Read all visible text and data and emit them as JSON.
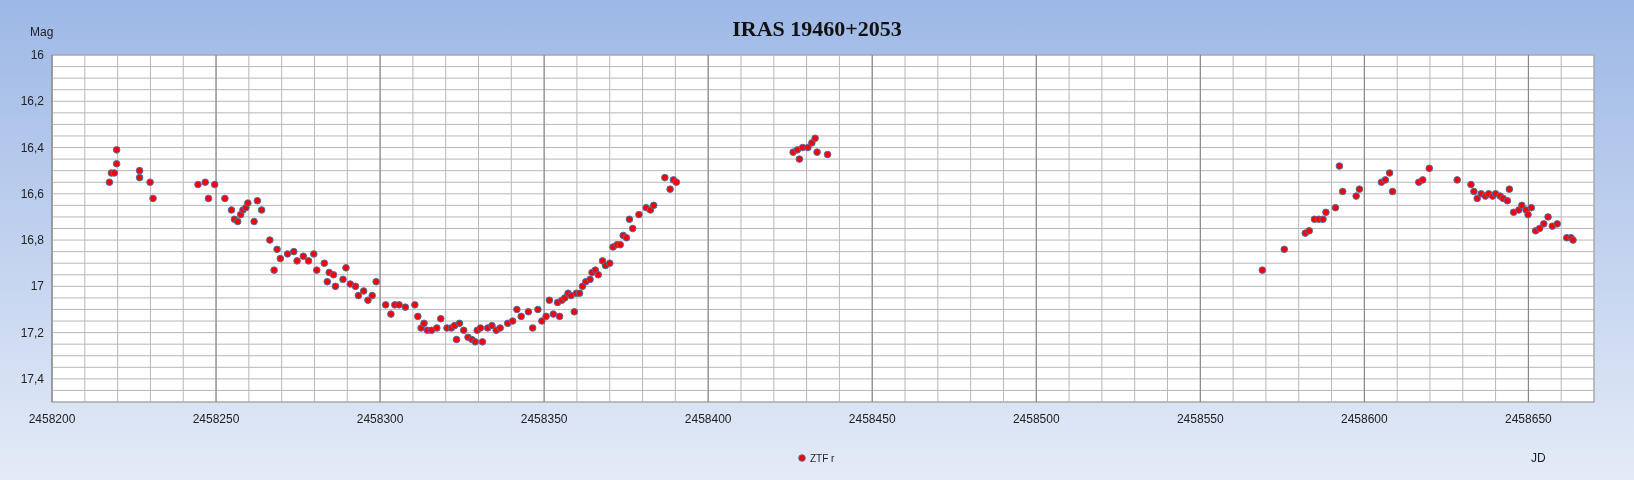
{
  "chart_data": {
    "type": "scatter",
    "grid": true,
    "title": "IRAS 19460+2053",
    "xlabel": "JD",
    "ylabel": "Mag",
    "xlim": [
      2458200,
      2458670
    ],
    "ylim": [
      17.5,
      16
    ],
    "xticks": [
      2458200,
      2458250,
      2458300,
      2458350,
      2458400,
      2458450,
      2458500,
      2458550,
      2458600,
      2458650
    ],
    "yticks": [
      {
        "value": 16,
        "label": "16"
      },
      {
        "value": 16.2,
        "label": "16,2"
      },
      {
        "value": 16.4,
        "label": "16,4"
      },
      {
        "value": 16.6,
        "label": "16,6"
      },
      {
        "value": 16.8,
        "label": "16,8"
      },
      {
        "value": 17,
        "label": "17"
      },
      {
        "value": 17.2,
        "label": "17,2"
      },
      {
        "value": 17.4,
        "label": "17,4"
      }
    ],
    "x": [
      2458217.5,
      2458218.1,
      2458219,
      2458219.7,
      2458219.7,
      2458226.7,
      2458226.7,
      2458229.9,
      2458230.8,
      2458244.5,
      2458246.7,
      2458247.7,
      2458249.6,
      2458252.7,
      2458254.7,
      2458255.6,
      2458256.6,
      2458257.5,
      2458258.2,
      2458259.1,
      2458259.7,
      2458261.6,
      2458262.6,
      2458263.9,
      2458266.4,
      2458267.7,
      2458268.6,
      2458269.6,
      2458271.8,
      2458273.7,
      2458274.7,
      2458276.6,
      2458278.2,
      2458279.8,
      2458280.7,
      2458283,
      2458283.9,
      2458284.5,
      2458285.8,
      2458286.4,
      2458288.7,
      2458289.6,
      2458290.9,
      2458292.5,
      2458293.4,
      2458295,
      2458296.3,
      2458297.6,
      2458298.8,
      2458301.7,
      2458303.3,
      2458304.5,
      2458305.8,
      2458307.7,
      2458310.6,
      2458311.5,
      2458312.5,
      2458313.4,
      2458314.4,
      2458315.7,
      2458317.3,
      2458318.5,
      2458320.4,
      2458321.7,
      2458322.7,
      2458323.3,
      2458324.2,
      2458325.5,
      2458326.8,
      2458328,
      2458329,
      2458329.6,
      2458330.6,
      2458331.2,
      2458332.8,
      2458334.1,
      2458335.4,
      2458336.6,
      2458338.9,
      2458340.4,
      2458341.7,
      2458343,
      2458345.2,
      2458346.5,
      2458348.1,
      2458349.3,
      2458350.6,
      2458351.6,
      2458352.8,
      2458354.1,
      2458354.7,
      2458355.4,
      2458356.3,
      2458357.3,
      2458358.2,
      2458359.2,
      2458359.8,
      2458360.8,
      2458361.7,
      2458362.7,
      2458364,
      2458364.6,
      2458365.6,
      2458366.5,
      2458367.8,
      2458368.7,
      2458370,
      2458371,
      2458372.2,
      2458373.2,
      2458374.1,
      2458375.1,
      2458376,
      2458377,
      2458378.9,
      2458381.1,
      2458382.4,
      2458383.4,
      2458386.8,
      2458388.4,
      2458389.4,
      2458390.3,
      2458425.9,
      2458427.2,
      2458427.8,
      2458428.8,
      2458430.4,
      2458431.6,
      2458432.6,
      2458433.2,
      2458436.4,
      2458568.9,
      2458575.6,
      2458582,
      2458583.2,
      2458584.8,
      2458586.1,
      2458587.4,
      2458588.3,
      2458591.2,
      2458592.4,
      2458593.4,
      2458597.5,
      2458598.5,
      2458605.2,
      2458606.4,
      2458607.7,
      2458608.6,
      2458616.6,
      2458617.8,
      2458619.8,
      2458628.3,
      2458632.5,
      2458633.4,
      2458634.4,
      2458635.6,
      2458636.9,
      2458637.9,
      2458639.1,
      2458640,
      2458641.4,
      2458642.3,
      2458643.6,
      2458644.2,
      2458645.5,
      2458647.1,
      2458648,
      2458649.3,
      2458649.9,
      2458650.9,
      2458652.2,
      2458653.4,
      2458654.7,
      2458656,
      2458657.3,
      2458658.8,
      2458661.7,
      2458663,
      2458663.6
    ],
    "series": [
      {
        "name": "ZTF r",
        "color": "#ff0000",
        "values": [
          16.55,
          16.51,
          16.51,
          16.41,
          16.47,
          16.5,
          16.53,
          16.55,
          16.62,
          16.56,
          16.55,
          16.62,
          16.56,
          16.62,
          16.67,
          16.71,
          16.72,
          16.69,
          16.67,
          16.66,
          16.64,
          16.72,
          16.63,
          16.67,
          16.8,
          16.93,
          16.84,
          16.88,
          16.86,
          16.85,
          16.89,
          16.87,
          16.89,
          16.86,
          16.93,
          16.9,
          16.98,
          16.94,
          16.95,
          17,
          16.97,
          16.92,
          16.99,
          17,
          17.04,
          17.02,
          17.06,
          17.04,
          16.98,
          17.08,
          17.12,
          17.08,
          17.08,
          17.09,
          17.08,
          17.13,
          17.18,
          17.16,
          17.19,
          17.19,
          17.18,
          17.14,
          17.18,
          17.18,
          17.17,
          17.23,
          17.16,
          17.19,
          17.22,
          17.23,
          17.24,
          17.19,
          17.18,
          17.24,
          17.18,
          17.17,
          17.19,
          17.18,
          17.16,
          17.15,
          17.1,
          17.13,
          17.11,
          17.18,
          17.1,
          17.15,
          17.13,
          17.06,
          17.12,
          17.07,
          17.13,
          17.06,
          17.05,
          17.03,
          17.04,
          17.11,
          17.03,
          17.03,
          17,
          16.98,
          16.97,
          16.94,
          16.93,
          16.95,
          16.89,
          16.91,
          16.9,
          16.83,
          16.82,
          16.82,
          16.78,
          16.79,
          16.71,
          16.75,
          16.69,
          16.66,
          16.67,
          16.65,
          16.53,
          16.58,
          16.54,
          16.55,
          16.42,
          16.41,
          16.45,
          16.4,
          16.4,
          16.38,
          16.36,
          16.42,
          16.43,
          16.93,
          16.84,
          16.77,
          16.76,
          16.71,
          16.71,
          16.71,
          16.68,
          16.66,
          16.48,
          16.59,
          16.61,
          16.58,
          16.55,
          16.54,
          16.51,
          16.59,
          16.55,
          16.54,
          16.49,
          16.54,
          16.56,
          16.59,
          16.62,
          16.6,
          16.61,
          16.6,
          16.61,
          16.6,
          16.61,
          16.62,
          16.63,
          16.58,
          16.68,
          16.67,
          16.65,
          16.67,
          16.69,
          16.66,
          16.76,
          16.75,
          16.73,
          16.7,
          16.74,
          16.73,
          16.79,
          16.79,
          16.8
        ]
      }
    ]
  }
}
